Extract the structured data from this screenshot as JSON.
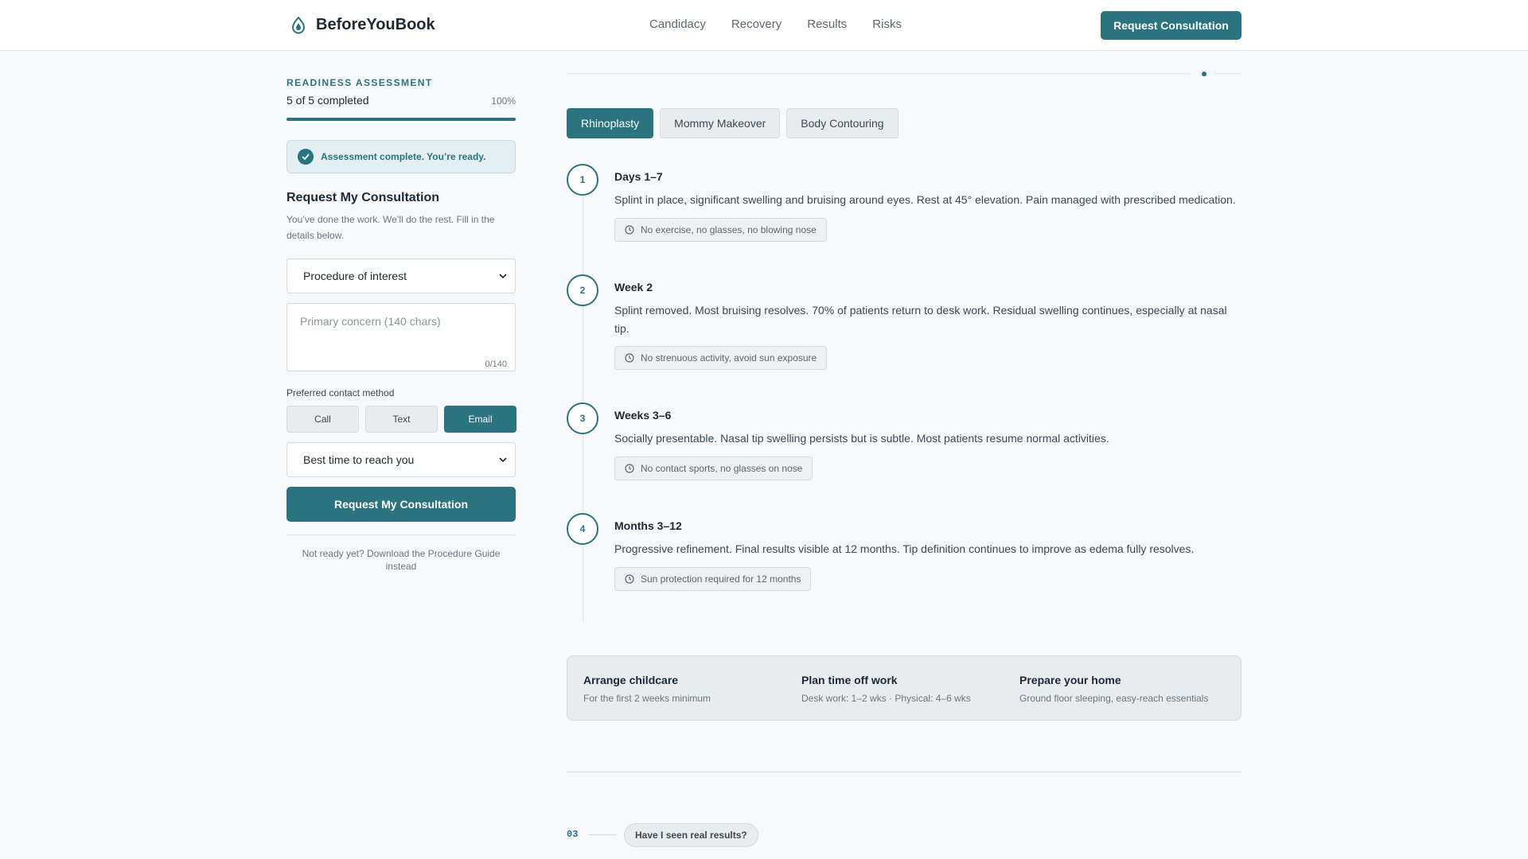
{
  "header": {
    "brand": "BeforeYouBook",
    "nav": [
      "Candidacy",
      "Recovery",
      "Results",
      "Risks"
    ],
    "cta": "Request Consultation"
  },
  "assessment": {
    "eyebrow": "READINESS ASSESSMENT",
    "completed_text": "5 of 5 completed",
    "percent_text": "100%",
    "progress_fraction": 1.0,
    "status": "Assessment complete. You’re ready."
  },
  "form": {
    "title": "Request My Consultation",
    "subtitle": "You’ve done the work. We’ll do the rest. Fill in the details below.",
    "procedure_select": "Procedure of interest",
    "concern_placeholder": "Primary concern (140 chars)",
    "char_count": "0/140",
    "contact_label": "Preferred contact method",
    "contact_options": [
      "Call",
      "Text",
      "Email"
    ],
    "contact_selected": "Email",
    "time_select": "Best time to reach you",
    "submit": "Request My Consultation",
    "not_ready": "Not ready yet? Download the Procedure Guide instead"
  },
  "procedure_tabs": [
    "Rhinoplasty",
    "Mommy Makeover",
    "Body Contouring"
  ],
  "active_tab": "Rhinoplasty",
  "timeline": [
    {
      "num": "1",
      "title": "Days 1–7",
      "desc": "Splint in place, significant swelling and bruising around eyes. Rest at 45° elevation. Pain managed with prescribed medication.",
      "tag": "No exercise, no glasses, no blowing nose"
    },
    {
      "num": "2",
      "title": "Week 2",
      "desc": "Splint removed. Most bruising resolves. 70% of patients return to desk work. Residual swelling continues, especially at nasal tip.",
      "tag": "No strenuous activity, avoid sun exposure"
    },
    {
      "num": "3",
      "title": "Weeks 3–6",
      "desc": "Socially presentable. Nasal tip swelling persists but is subtle. Most patients resume normal activities.",
      "tag": "No contact sports, no glasses on nose"
    },
    {
      "num": "4",
      "title": "Months 3–12",
      "desc": "Progressive refinement. Final results visible at 12 months. Tip definition continues to improve as edema fully resolves.",
      "tag": "Sun protection required for 12 months"
    }
  ],
  "prep": [
    {
      "title": "Arrange childcare",
      "sub": "For the first 2 weeks minimum"
    },
    {
      "title": "Plan time off work",
      "sub": "Desk work: 1–2 wks · Physical: 4–6 wks"
    },
    {
      "title": "Prepare your home",
      "sub": "Ground floor sleeping, easy-reach essentials"
    }
  ],
  "next_section": {
    "num": "03",
    "question": "Have I seen real results?"
  },
  "colors": {
    "accent": "#2a7480",
    "background": "#f6f8fa",
    "card": "#e8ecef"
  },
  "icons": {
    "brand": "brand-drop-icon",
    "check": "check-icon",
    "clock": "clock-icon",
    "chevron": "chevron-down-icon"
  }
}
